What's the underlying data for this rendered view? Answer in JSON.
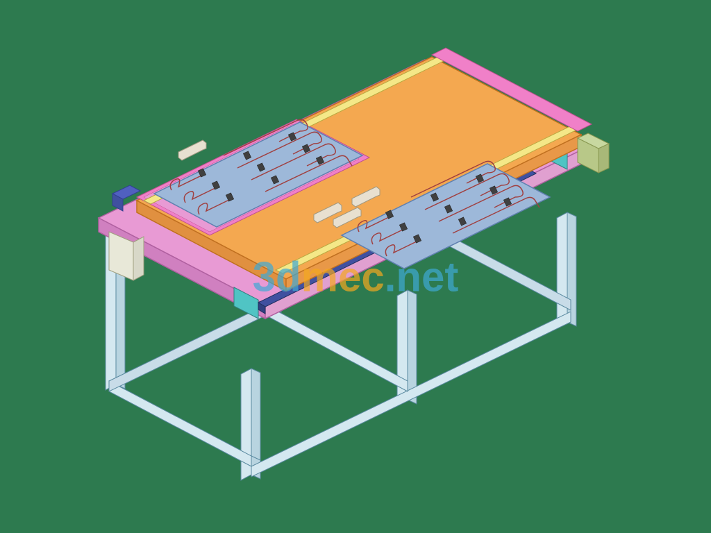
{
  "watermark": {
    "part1": "3d",
    "part2": "mec",
    "part3": ".net"
  },
  "model": {
    "description": "Isometric CAD model of workbench fixture assembly",
    "colors": {
      "background": "#2d7a4f",
      "frame": "#d4e8f0",
      "frame_edge": "#5a8aa0",
      "tabletop": "#e89ad4",
      "tabletop_edge": "#b060a0",
      "plate_top": "#9db8d9",
      "plate_frame_left": "#f080c8",
      "plate_frame_right": "#f4a850",
      "rail": "#f4e888",
      "bracket": "#50c4c4",
      "handle": "#e8e0d0",
      "pins": "#404040",
      "wire": "#a04040",
      "actuator": "#4050a0"
    }
  }
}
